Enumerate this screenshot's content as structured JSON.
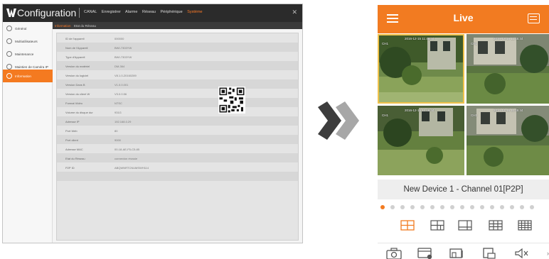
{
  "dvr": {
    "title": "Configuration",
    "top_menu": [
      "CANAL",
      "Enregistrer",
      "Alarme",
      "Réseau",
      "Périphérique",
      "Système"
    ],
    "top_menu_active": 5,
    "sidebar": [
      {
        "label": "Général",
        "icon": "settings-icon"
      },
      {
        "label": "Multiutilisateurs",
        "icon": "users-icon"
      },
      {
        "label": "Maintenance",
        "icon": "wrench-icon"
      },
      {
        "label": "Maintien de Caméra IP",
        "icon": "camera-maintenance-icon"
      },
      {
        "label": "Information",
        "icon": "info-icon"
      }
    ],
    "sidebar_active": 4,
    "tabs": [
      "Information",
      "Etat du Réseau"
    ],
    "tabs_active": 0,
    "info_rows": [
      {
        "key": "ID de l'appareil",
        "value": "000000"
      },
      {
        "key": "Nom de l'Appareil",
        "value": "BWI-7303YW"
      },
      {
        "key": "Type d'Appareil",
        "value": "BWI-7303YW"
      },
      {
        "key": "Version du matériel",
        "value": "DM-364"
      },
      {
        "key": "Version du logiciel",
        "value": "V8.1.0-20160289"
      },
      {
        "key": "Version Dans B",
        "value": "V1.0.0.001"
      },
      {
        "key": "Version du client W",
        "value": "V3.0.0.56"
      },
      {
        "key": "Format Vidéo",
        "value": "NTSC"
      },
      {
        "key": "Volume du disque dur",
        "value": "931G"
      },
      {
        "key": "Adresse IP",
        "value": "192.168.0.29"
      },
      {
        "key": "Port Web",
        "value": "80"
      },
      {
        "key": "Port client",
        "value": "9000"
      },
      {
        "key": "Adresse MAC",
        "value": "00-18-AE-F5-C5-85"
      },
      {
        "key": "Etat du Réseau",
        "value": "connexion réussie"
      },
      {
        "key": "P2P ID",
        "value": "ABQWNRTCNUMSWH114"
      }
    ]
  },
  "phone": {
    "title": "Live",
    "channel_name": "New Device 1 - Channel 01[P2P]",
    "cameras": [
      {
        "channel": "CH1",
        "timestamp": "2016-12-15 11:45:44"
      },
      {
        "channel": "CH1",
        "timestamp": "2016-12-15 11:45:44"
      },
      {
        "channel": "CH1",
        "timestamp": "2016-12-15 11:45:44"
      },
      {
        "channel": "CH1",
        "timestamp": "2016-12-15 11:45:44"
      }
    ],
    "page_dots": 16,
    "active_dot": 0,
    "accent": "#f27b21"
  }
}
